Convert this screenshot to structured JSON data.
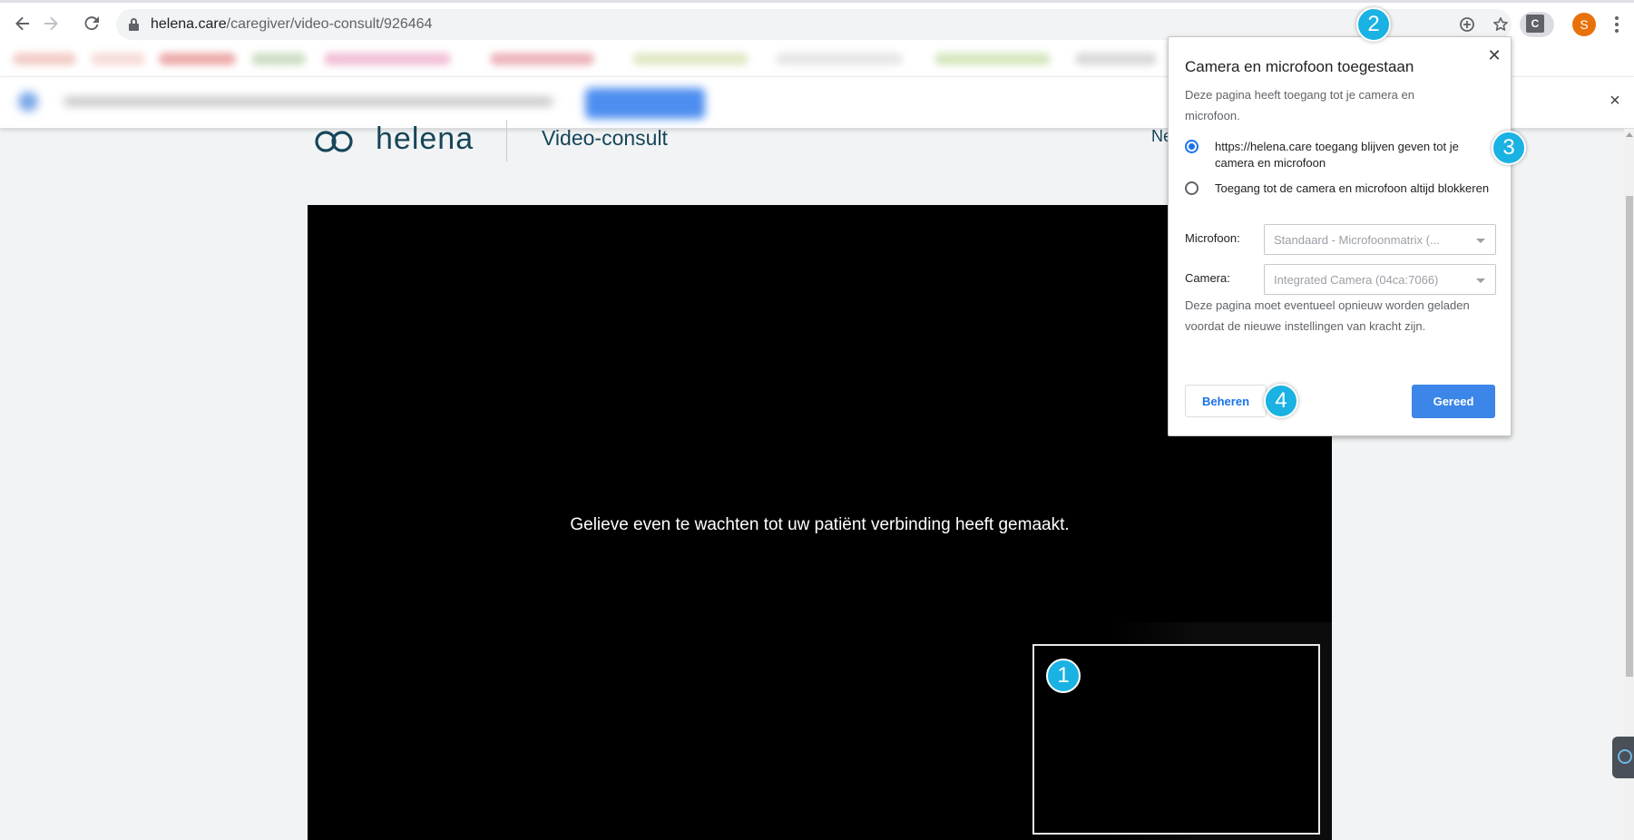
{
  "browser": {
    "url_host": "helena.care",
    "url_path": "/caregiver/video-consult/926464",
    "profile_initial": "S",
    "extension_label": "C",
    "icons": [
      "back-arrow-icon",
      "forward-arrow-icon",
      "reload-icon",
      "lock-icon",
      "camera-icon",
      "add-icon",
      "star-icon",
      "kebab-menu-icon"
    ]
  },
  "infobar": {
    "close_label": "×"
  },
  "page": {
    "logo_text": "helena",
    "title": "Video-consult",
    "header_right": "Ne"
  },
  "video": {
    "waiting_text": "Gelieve even te wachten tot uw patiënt verbinding heeft gemaakt."
  },
  "popup": {
    "title": "Camera en microfoon toegestaan",
    "close_label": "✕",
    "description": "Deze pagina heeft toegang tot je camera en microfoon.",
    "options": [
      {
        "label": "https://helena.care toegang blijven geven tot je camera en microfoon",
        "selected": true
      },
      {
        "label": "Toegang tot de camera en microfoon altijd blokkeren",
        "selected": false
      }
    ],
    "microphone_label": "Microfoon:",
    "microphone_value": "Standaard - Microfoonmatrix (...",
    "camera_label": "Camera:",
    "camera_value": "Integrated Camera (04ca:7066)",
    "note": "Deze pagina moet eventueel opnieuw worden geladen voordat de nieuwe instellingen van kracht zijn.",
    "manage_label": "Beheren",
    "done_label": "Gereed"
  },
  "markers": [
    "1",
    "2",
    "3",
    "4"
  ],
  "colors": {
    "marker": "#1ab2e3",
    "brand": "#17455a",
    "primary_button": "#3b86e8",
    "avatar": "#e8710a"
  }
}
